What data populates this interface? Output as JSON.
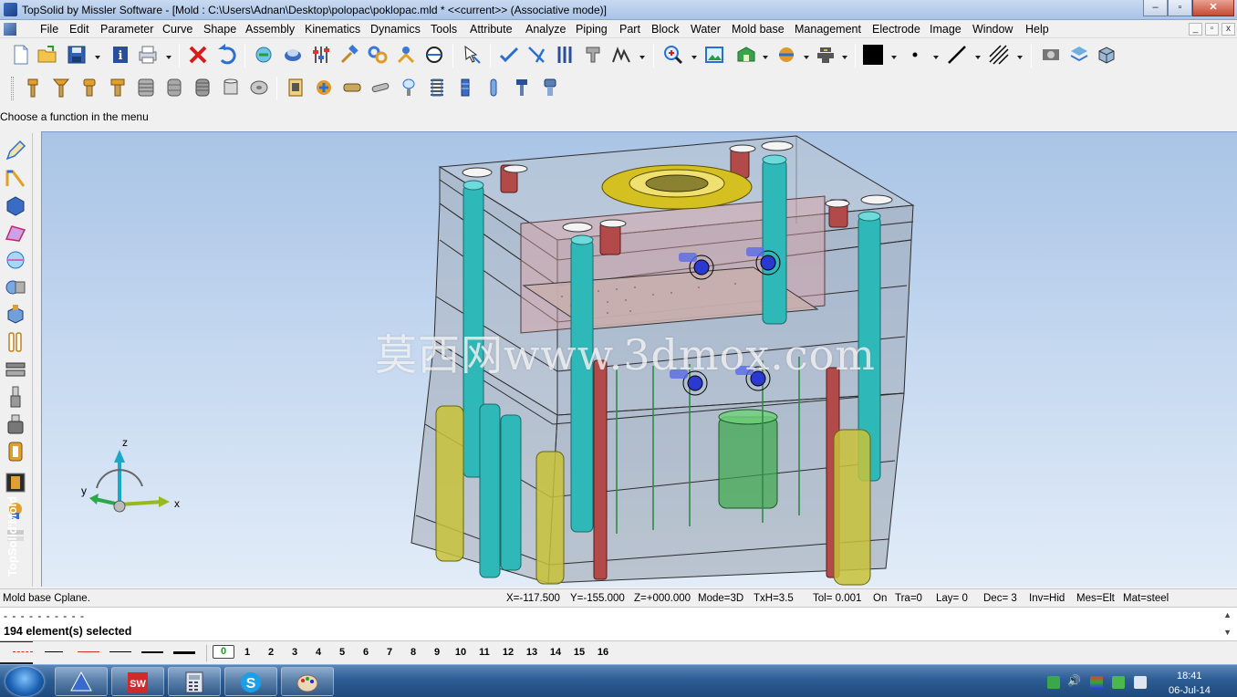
{
  "window": {
    "title": "TopSolid by Missler Software - [Mold : C:\\Users\\Adnan\\Desktop\\polopac\\poklopac.mld *  <<current>> (Associative mode)]",
    "minimize": "–",
    "maximize": "▫",
    "close": "✕"
  },
  "menu": [
    "File",
    "Edit",
    "Parameter",
    "Curve",
    "Shape",
    "Assembly",
    "Kinematics",
    "Dynamics",
    "Tools",
    "Attribute",
    "Analyze",
    "Piping",
    "Part",
    "Block",
    "Water",
    "Mold base",
    "Management",
    "Electrode",
    "Image",
    "Window",
    "Help"
  ],
  "prompt": "Choose a function in the menu",
  "viewport": {
    "watermark": "莫西网www.3dmox.com",
    "axes": {
      "x": "x",
      "y": "y",
      "z": "z"
    }
  },
  "brand": "TopSolid'Mold",
  "status": {
    "left": "Mold base Cplane.",
    "x": "X=-117.500",
    "y": "Y=-155.000",
    "z": "Z=+000.000",
    "mode": "Mode=3D",
    "txh": "TxH=3.5",
    "tol": "Tol= 0.001",
    "on": "On",
    "tra": "Tra=0",
    "lay": "Lay=  0",
    "dec": "Dec= 3",
    "inv": "Inv=Hid",
    "mes": "Mes=Elt",
    "mat": "Mat=steel"
  },
  "messages": {
    "line1": "- - - - - - - - - -",
    "line2": "194 element(s) selected"
  },
  "layers": [
    "0",
    "1",
    "2",
    "3",
    "4",
    "5",
    "6",
    "7",
    "8",
    "9",
    "10",
    "11",
    "12",
    "13",
    "14",
    "15",
    "16"
  ],
  "current_layer": "0",
  "taskbar": {
    "time": "18:41",
    "date": "06-Jul-14"
  },
  "colors": {
    "viewport_top": "#a9c4e6",
    "viewport_bottom": "#e2ecf8",
    "mold_plate": "#b5bcc6",
    "guide_pillar": "#2fb8b8",
    "screw": "#b24a4a",
    "support": "#c8c23a"
  }
}
